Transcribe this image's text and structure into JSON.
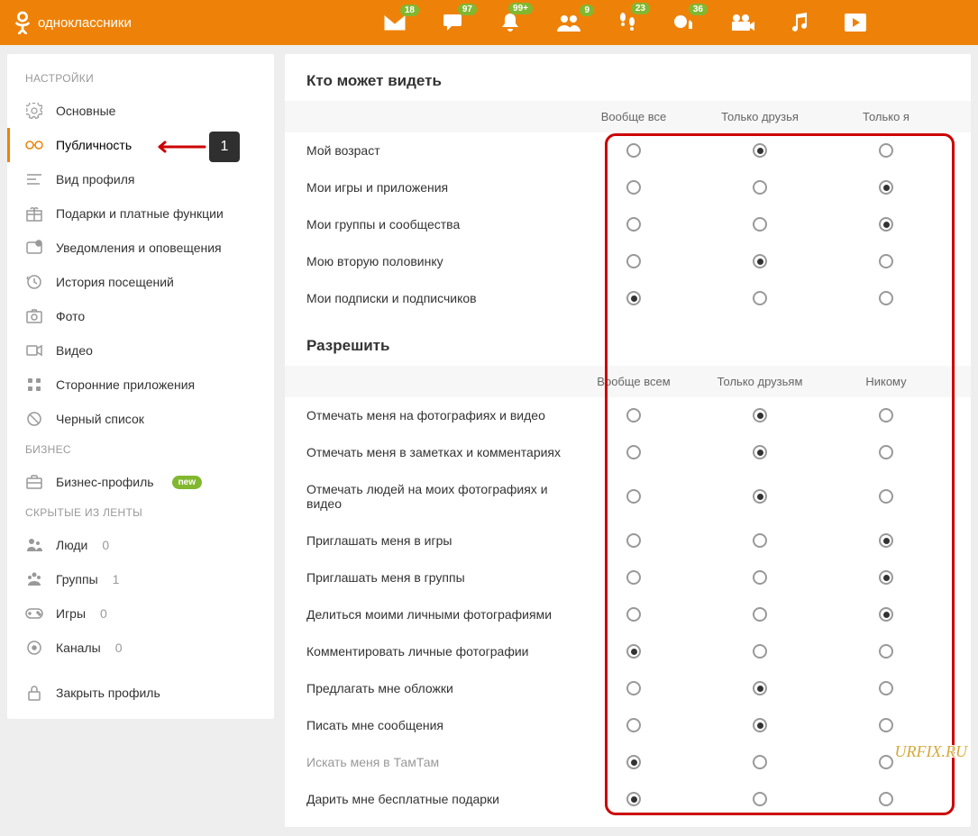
{
  "logo_text": "одноклассники",
  "nav_badges": {
    "messages": "18",
    "discussions": "97",
    "notifications": "99+",
    "friends": "9",
    "guests": "23",
    "feedback": "36"
  },
  "sidebar": {
    "section1": "НАСТРОЙКИ",
    "items": [
      {
        "label": "Основные"
      },
      {
        "label": "Публичность",
        "active": true,
        "annotation": "1"
      },
      {
        "label": "Вид профиля"
      },
      {
        "label": "Подарки и платные функции"
      },
      {
        "label": "Уведомления и оповещения"
      },
      {
        "label": "История посещений"
      },
      {
        "label": "Фото"
      },
      {
        "label": "Видео"
      },
      {
        "label": "Сторонние приложения"
      },
      {
        "label": "Черный список"
      }
    ],
    "section2": "БИЗНЕС",
    "business": {
      "label": "Бизнес-профиль",
      "new": "new"
    },
    "section3": "СКРЫТЫЕ ИЗ ЛЕНТЫ",
    "hidden": [
      {
        "label": "Люди",
        "count": "0"
      },
      {
        "label": "Группы",
        "count": "1"
      },
      {
        "label": "Игры",
        "count": "0"
      },
      {
        "label": "Каналы",
        "count": "0"
      }
    ],
    "lock": {
      "label": "Закрыть профиль"
    }
  },
  "main": {
    "visibility": {
      "title": "Кто может видеть",
      "columns": [
        "Вообще все",
        "Только друзья",
        "Только я"
      ],
      "rows": [
        {
          "label": "Мой возраст",
          "sel": 1
        },
        {
          "label": "Мои игры и приложения",
          "sel": 2
        },
        {
          "label": "Мои группы и сообщества",
          "sel": 2
        },
        {
          "label": "Мою вторую половинку",
          "sel": 1
        },
        {
          "label": "Мои подписки и подписчиков",
          "sel": 0
        }
      ]
    },
    "permissions": {
      "title": "Разрешить",
      "columns": [
        "Вообще всем",
        "Только друзьям",
        "Никому"
      ],
      "rows": [
        {
          "label": "Отмечать меня на фотографиях и видео",
          "sel": 1
        },
        {
          "label": "Отмечать меня в заметках и комментариях",
          "sel": 1
        },
        {
          "label": "Отмечать людей на моих фотографиях и видео",
          "sel": 1
        },
        {
          "label": "Приглашать меня в игры",
          "sel": 2
        },
        {
          "label": "Приглашать меня в группы",
          "sel": 2
        },
        {
          "label": "Делиться моими личными фотографиями",
          "sel": 2
        },
        {
          "label": "Комментировать личные фотографии",
          "sel": 0
        },
        {
          "label": "Предлагать мне обложки",
          "sel": 1
        },
        {
          "label": "Писать мне сообщения",
          "sel": 1
        },
        {
          "label": "Искать меня в ТамТам",
          "sel": 0,
          "muted": true
        },
        {
          "label": "Дарить мне бесплатные подарки",
          "sel": 0
        }
      ]
    }
  },
  "watermark": "URFIX.RU"
}
